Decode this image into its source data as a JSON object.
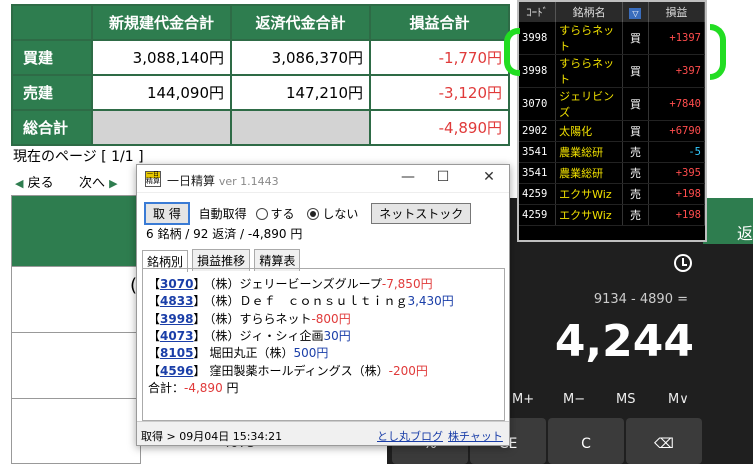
{
  "summary": {
    "headers": [
      "新規建代金合計",
      "返済代金合計",
      "損益合計"
    ],
    "rows": [
      {
        "label": "買建",
        "new": "3,088,140円",
        "close": "3,086,370円",
        "pl": "-1,770円"
      },
      {
        "label": "売建",
        "new": "144,090円",
        "close": "147,210円",
        "pl": "-3,120円"
      },
      {
        "label": "総合計",
        "pl": "-4,890円"
      }
    ]
  },
  "pager": {
    "current": "現在のページ [ 1/1 ]",
    "back": "戻る",
    "next": "次へ"
  },
  "background": {
    "mark": "(",
    "num": "4073"
  },
  "stocklist": {
    "headers": {
      "code": "ｺｰﾄﾞ",
      "name": "銘柄名",
      "sort": "▽",
      "pl": "損益"
    },
    "rows": [
      {
        "code": "3998",
        "name": "すららネット",
        "side": "買",
        "pl": "+1397",
        "color": "red"
      },
      {
        "code": "3998",
        "name": "すららネット",
        "side": "買",
        "pl": "+397",
        "color": "red"
      },
      {
        "code": "3070",
        "name": "ジェリビンズ",
        "side": "買",
        "pl": "+7840",
        "color": "red"
      },
      {
        "code": "2902",
        "name": "太陽化",
        "side": "買",
        "pl": "+6790",
        "color": "red"
      },
      {
        "code": "3541",
        "name": "農業総研",
        "side": "売",
        "pl": "-5",
        "color": "cyan"
      },
      {
        "code": "3541",
        "name": "農業総研",
        "side": "売",
        "pl": "+395",
        "color": "red"
      },
      {
        "code": "4259",
        "name": "エクサWiz",
        "side": "売",
        "pl": "+198",
        "color": "red"
      },
      {
        "code": "4259",
        "name": "エクサWiz",
        "side": "売",
        "pl": "+198",
        "color": "red"
      }
    ]
  },
  "popup": {
    "icon_top": "一日",
    "icon_bottom": "精算",
    "title": "一日精算",
    "version": "ver 1.1443",
    "fetch_button": "取 得",
    "auto_label": "自動取得",
    "radio_on": "する",
    "radio_off": "しない",
    "netstock_button": "ネットストック",
    "summary": "6 銘柄 / 92 返済 / -4,890 円",
    "tabs": [
      "銘柄別",
      "損益推移",
      "精算表"
    ],
    "entries": [
      {
        "code": "3070",
        "name": "（株）ジェリービーンズグループ",
        "pl": "-7,850円",
        "sign": "loss"
      },
      {
        "code": "4833",
        "name": "（株）Ｄｅｆ　ｃｏｎｓｕｌｔｉｎｇ",
        "pl": "3,430円",
        "sign": "gain"
      },
      {
        "code": "3998",
        "name": "（株）すららネット",
        "pl": "-800円",
        "sign": "loss"
      },
      {
        "code": "4073",
        "name": "（株）ジィ・シィ企画",
        "pl": "30円",
        "sign": "gain"
      },
      {
        "code": "8105",
        "name": "堀田丸正（株）",
        "pl": "500円",
        "sign": "gain"
      },
      {
        "code": "4596",
        "name": "窪田製薬ホールディングス（株）",
        "pl": "-200円",
        "sign": "loss"
      }
    ],
    "total_label": "合計：",
    "total_value": "-4,890",
    "total_unit": "円",
    "status": "取得 > 09月04日 15:34:21",
    "link1": "とし丸ブログ",
    "link2": "株チャット"
  },
  "calculator": {
    "right_edge_label": "返",
    "expression": "9134 - 4890 =",
    "result": "4,244",
    "memory": [
      "M+",
      "M−",
      "MS",
      "M∨"
    ],
    "keys": [
      "%",
      "CE",
      "C",
      "⌫"
    ]
  }
}
